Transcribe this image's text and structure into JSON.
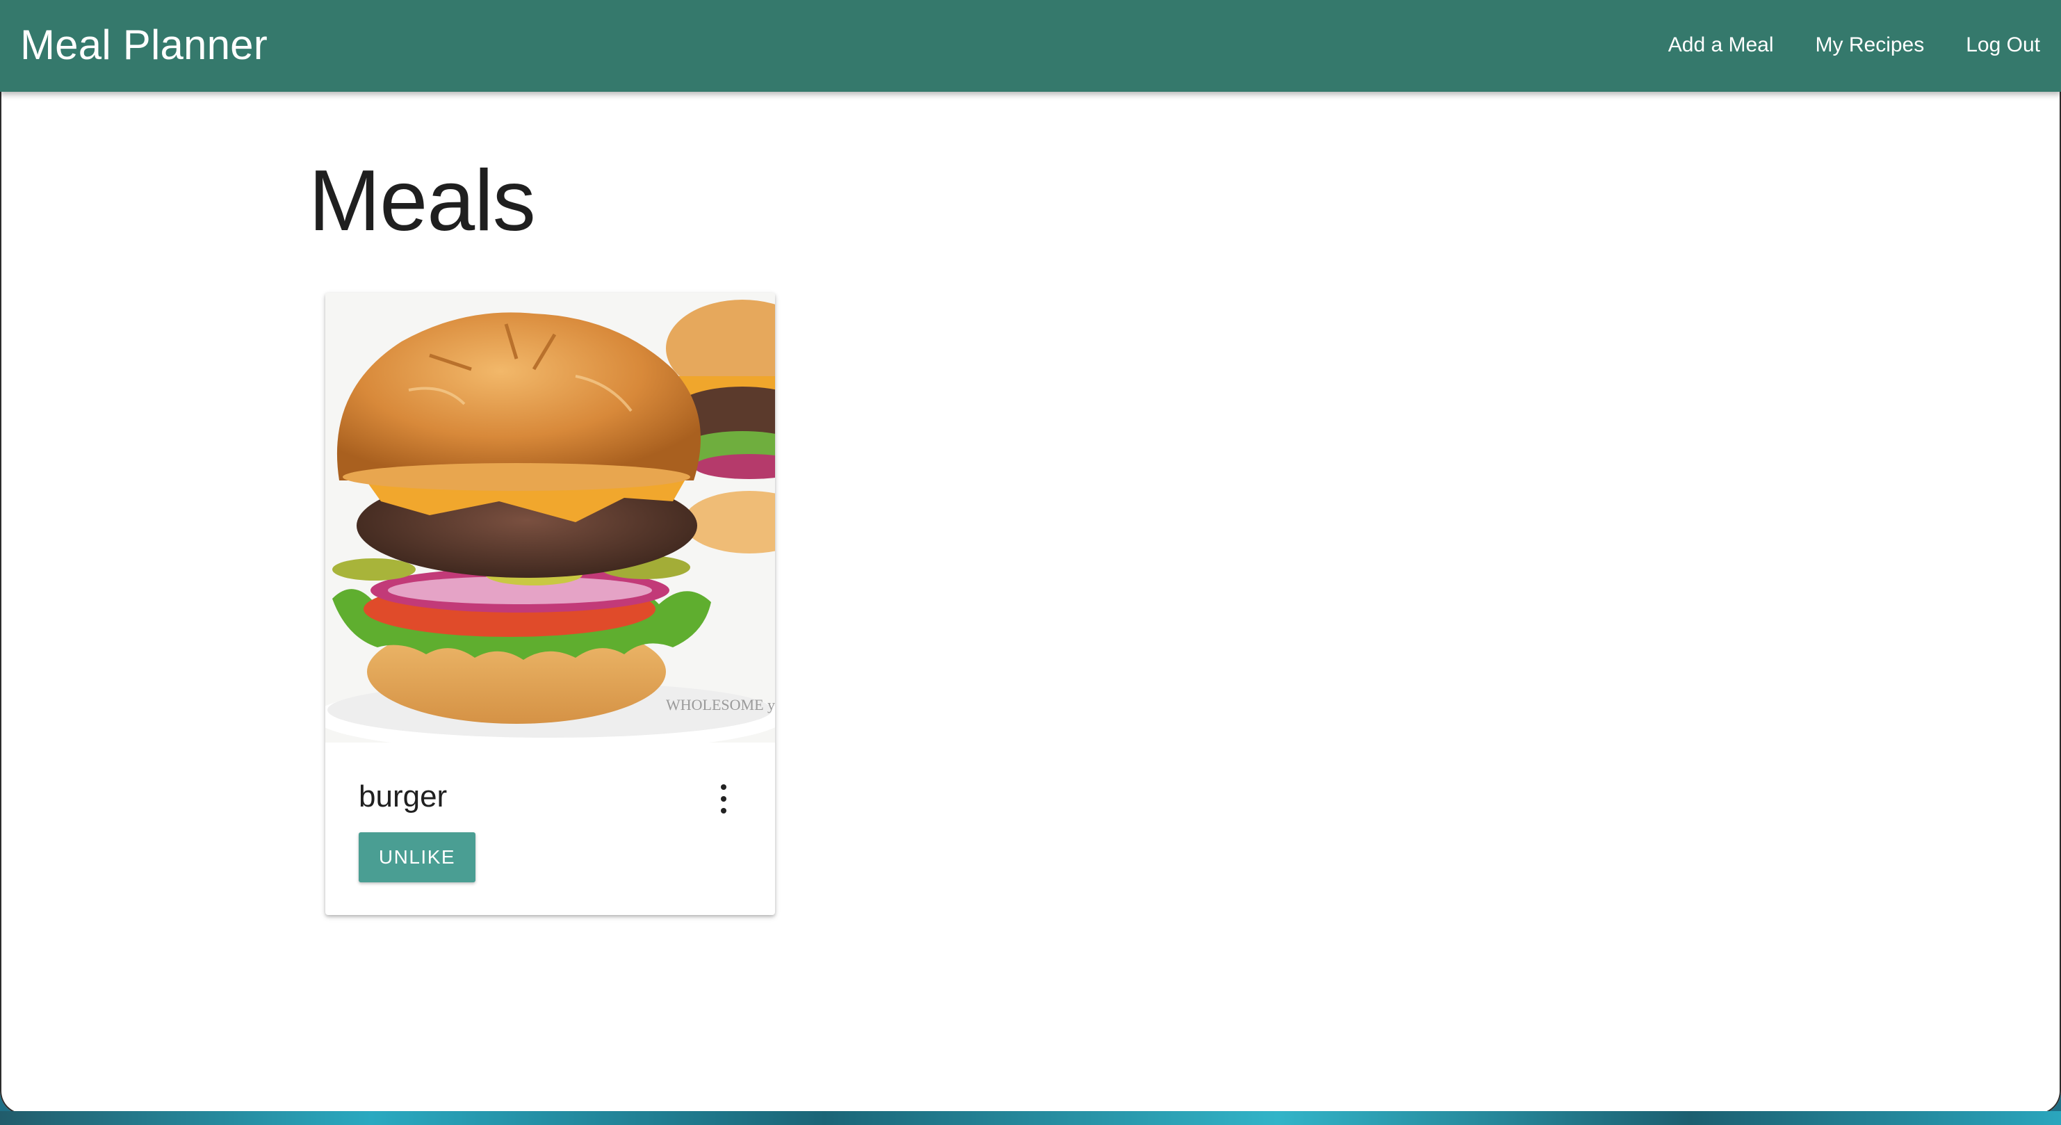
{
  "navbar": {
    "brand": "Meal Planner",
    "links": [
      {
        "label": "Add a Meal"
      },
      {
        "label": "My Recipes"
      },
      {
        "label": "Log Out"
      }
    ]
  },
  "main": {
    "title": "Meals",
    "meals": [
      {
        "name": "burger",
        "image_watermark": "WHOLESOME yum",
        "button_label": "UNLIKE",
        "menu_icon": "more-vert-icon"
      }
    ]
  },
  "colors": {
    "navbar": "#35796c",
    "button": "#4a9e93",
    "text": "#1f1f1f"
  }
}
